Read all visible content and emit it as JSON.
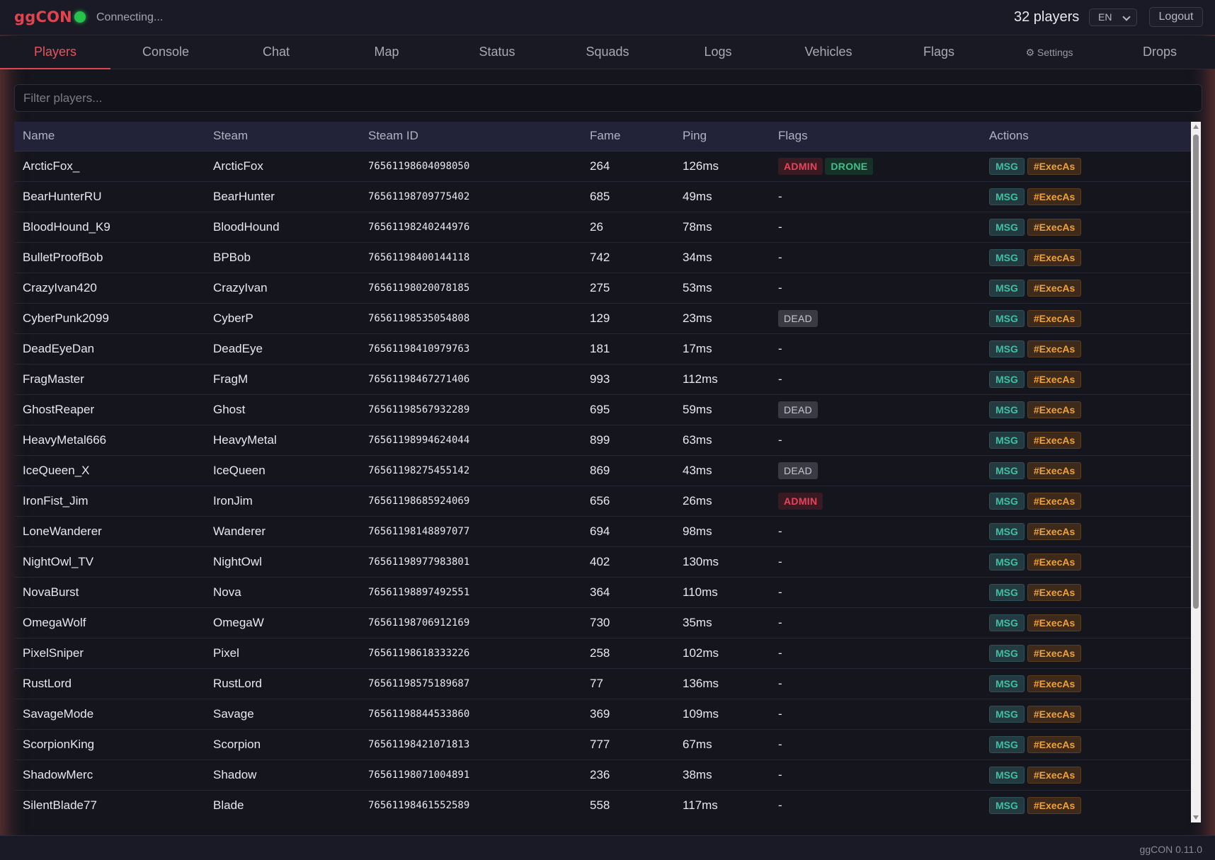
{
  "app": {
    "logo": "ggCON",
    "status_text": "Connecting...",
    "status_color": "#27c24c",
    "player_count": "32 players",
    "language": "EN",
    "logout_label": "Logout",
    "version": "ggCON 0.11.0"
  },
  "tabs": [
    {
      "label": "Players",
      "active": true
    },
    {
      "label": "Console"
    },
    {
      "label": "Chat"
    },
    {
      "label": "Map"
    },
    {
      "label": "Status"
    },
    {
      "label": "Squads"
    },
    {
      "label": "Logs"
    },
    {
      "label": "Vehicles"
    },
    {
      "label": "Flags"
    },
    {
      "label": "⚙ Settings"
    },
    {
      "label": "Drops"
    }
  ],
  "filter": {
    "placeholder": "Filter players...",
    "value": ""
  },
  "table": {
    "columns": [
      "Name",
      "Steam",
      "Steam ID",
      "Fame",
      "Ping",
      "Flags",
      "Actions"
    ],
    "action_labels": {
      "msg": "MSG",
      "exec": "#ExecAs"
    },
    "rows": [
      {
        "name": "ArcticFox_",
        "steam": "ArcticFox",
        "steam_id": "76561198604098050",
        "fame": "264",
        "ping": "126ms",
        "flags": [
          "ADMIN",
          "DRONE"
        ]
      },
      {
        "name": "BearHunterRU",
        "steam": "BearHunter",
        "steam_id": "76561198709775402",
        "fame": "685",
        "ping": "49ms",
        "flags": []
      },
      {
        "name": "BloodHound_K9",
        "steam": "BloodHound",
        "steam_id": "76561198240244976",
        "fame": "26",
        "ping": "78ms",
        "flags": []
      },
      {
        "name": "BulletProofBob",
        "steam": "BPBob",
        "steam_id": "76561198400144118",
        "fame": "742",
        "ping": "34ms",
        "flags": []
      },
      {
        "name": "CrazyIvan420",
        "steam": "CrazyIvan",
        "steam_id": "76561198020078185",
        "fame": "275",
        "ping": "53ms",
        "flags": []
      },
      {
        "name": "CyberPunk2099",
        "steam": "CyberP",
        "steam_id": "76561198535054808",
        "fame": "129",
        "ping": "23ms",
        "flags": [
          "DEAD"
        ]
      },
      {
        "name": "DeadEyeDan",
        "steam": "DeadEye",
        "steam_id": "76561198410979763",
        "fame": "181",
        "ping": "17ms",
        "flags": []
      },
      {
        "name": "FragMaster",
        "steam": "FragM",
        "steam_id": "76561198467271406",
        "fame": "993",
        "ping": "112ms",
        "flags": []
      },
      {
        "name": "GhostReaper",
        "steam": "Ghost",
        "steam_id": "76561198567932289",
        "fame": "695",
        "ping": "59ms",
        "flags": [
          "DEAD"
        ]
      },
      {
        "name": "HeavyMetal666",
        "steam": "HeavyMetal",
        "steam_id": "76561198994624044",
        "fame": "899",
        "ping": "63ms",
        "flags": []
      },
      {
        "name": "IceQueen_X",
        "steam": "IceQueen",
        "steam_id": "76561198275455142",
        "fame": "869",
        "ping": "43ms",
        "flags": [
          "DEAD"
        ]
      },
      {
        "name": "IronFist_Jim",
        "steam": "IronJim",
        "steam_id": "76561198685924069",
        "fame": "656",
        "ping": "26ms",
        "flags": [
          "ADMIN"
        ]
      },
      {
        "name": "LoneWanderer",
        "steam": "Wanderer",
        "steam_id": "76561198148897077",
        "fame": "694",
        "ping": "98ms",
        "flags": []
      },
      {
        "name": "NightOwl_TV",
        "steam": "NightOwl",
        "steam_id": "76561198977983801",
        "fame": "402",
        "ping": "130ms",
        "flags": []
      },
      {
        "name": "NovaBurst",
        "steam": "Nova",
        "steam_id": "76561198897492551",
        "fame": "364",
        "ping": "110ms",
        "flags": []
      },
      {
        "name": "OmegaWolf",
        "steam": "OmegaW",
        "steam_id": "76561198706912169",
        "fame": "730",
        "ping": "35ms",
        "flags": []
      },
      {
        "name": "PixelSniper",
        "steam": "Pixel",
        "steam_id": "76561198618333226",
        "fame": "258",
        "ping": "102ms",
        "flags": []
      },
      {
        "name": "RustLord",
        "steam": "RustLord",
        "steam_id": "76561198575189687",
        "fame": "77",
        "ping": "136ms",
        "flags": []
      },
      {
        "name": "SavageMode",
        "steam": "Savage",
        "steam_id": "76561198844533860",
        "fame": "369",
        "ping": "109ms",
        "flags": []
      },
      {
        "name": "ScorpionKing",
        "steam": "Scorpion",
        "steam_id": "76561198421071813",
        "fame": "777",
        "ping": "67ms",
        "flags": []
      },
      {
        "name": "ShadowMerc",
        "steam": "Shadow",
        "steam_id": "76561198071004891",
        "fame": "236",
        "ping": "38ms",
        "flags": []
      },
      {
        "name": "SilentBlade77",
        "steam": "Blade",
        "steam_id": "76561198461552589",
        "fame": "558",
        "ping": "117ms",
        "flags": []
      }
    ],
    "empty_flag": "-"
  },
  "colors": {
    "accent": "#e0454f",
    "admin": "#e8435a",
    "drone": "#3fc08b",
    "msg": "#3fc0a4",
    "exec": "#f0a23a"
  }
}
